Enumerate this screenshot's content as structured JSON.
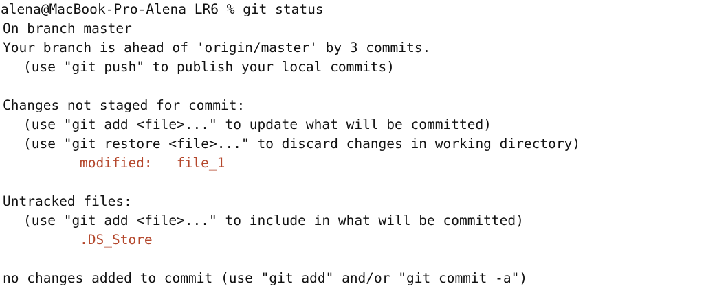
{
  "terminal": {
    "prompt": "alena@MacBook-Pro-Alena LR6 % git status",
    "branch_line": "On branch master",
    "ahead_line": "Your branch is ahead of 'origin/master' by 3 commits.",
    "push_hint": "(use \"git push\" to publish your local commits)",
    "unstaged_header": "Changes not staged for commit:",
    "unstaged_hint_add": "(use \"git add <file>...\" to update what will be committed)",
    "unstaged_hint_restore": "(use \"git restore <file>...\" to discard changes in working directory)",
    "modified_entry": "modified:   file_1",
    "untracked_header": "Untracked files:",
    "untracked_hint": "(use \"git add <file>...\" to include in what will be committed)",
    "untracked_entry": ".DS_Store",
    "summary_line": "no changes added to commit (use \"git add\" and/or \"git commit -a\")"
  },
  "colors": {
    "background": "#ffffff",
    "text": "#111111",
    "git_status_red": "#b4472c"
  }
}
